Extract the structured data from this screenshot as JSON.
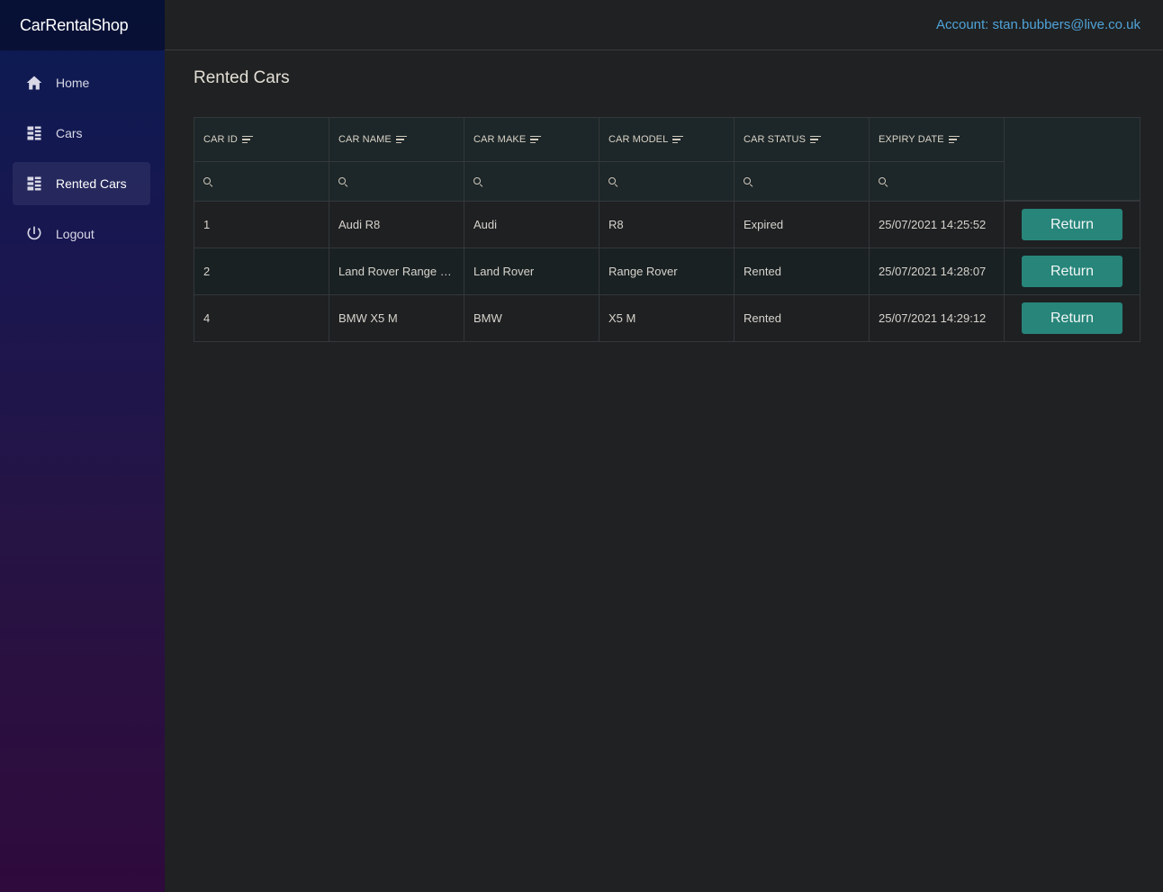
{
  "app": {
    "brand": "CarRentalShop"
  },
  "account": {
    "label": "Account: stan.bubbers@live.co.uk"
  },
  "sidebar": {
    "items": [
      {
        "label": "Home",
        "icon": "home-icon",
        "active": false
      },
      {
        "label": "Cars",
        "icon": "list-icon",
        "active": false
      },
      {
        "label": "Rented Cars",
        "icon": "list-icon",
        "active": true
      },
      {
        "label": "Logout",
        "icon": "power-icon",
        "active": false
      }
    ]
  },
  "page": {
    "title": "Rented Cars"
  },
  "table": {
    "columns": [
      "CAR ID",
      "CAR NAME",
      "CAR MAKE",
      "CAR MODEL",
      "CAR STATUS",
      "EXPIRY DATE"
    ],
    "rows": [
      {
        "id": "1",
        "name": "Audi R8",
        "make": "Audi",
        "model": "R8",
        "status": "Expired",
        "expiry": "25/07/2021 14:25:52",
        "action": "Return"
      },
      {
        "id": "2",
        "name": "Land Rover Range Rover",
        "make": "Land Rover",
        "model": "Range Rover",
        "status": "Rented",
        "expiry": "25/07/2021 14:28:07",
        "action": "Return"
      },
      {
        "id": "4",
        "name": "BMW X5 M",
        "make": "BMW",
        "model": "X5 M",
        "status": "Rented",
        "expiry": "25/07/2021 14:29:12",
        "action": "Return"
      }
    ]
  },
  "colors": {
    "accent_button": "#27857a",
    "account_link": "#4fa3d8",
    "background": "#202122"
  }
}
